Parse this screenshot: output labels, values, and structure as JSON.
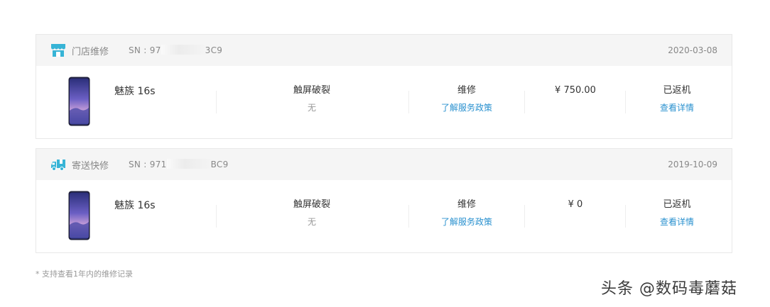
{
  "colors": {
    "accent": "#2a91cf",
    "type_icon": "#37b4d6",
    "header_bg": "#f5f5f5"
  },
  "records": [
    {
      "type_icon": "store-icon",
      "type_label": "门店维修",
      "sn_prefix": "SN : 97",
      "sn_suffix": "3C9",
      "date": "2020-03-08",
      "product": "魅族 16s",
      "issue": "触屏破裂",
      "issue_note": "无",
      "service": "维修",
      "policy_link": "了解服务政策",
      "price": "¥ 750.00",
      "status": "已返机",
      "detail_link": "查看详情"
    },
    {
      "type_icon": "truck-icon",
      "type_label": "寄送快修",
      "sn_prefix": "SN : 971",
      "sn_suffix": "BC9",
      "date": "2019-10-09",
      "product": "魅族 16s",
      "issue": "触屏破裂",
      "issue_note": "无",
      "service": "维修",
      "policy_link": "了解服务政策",
      "price": "¥ 0",
      "status": "已返机",
      "detail_link": "查看详情"
    }
  ],
  "footnote": "* 支持查看1年内的维修记录",
  "watermark": "头条 @数码毒蘑菇"
}
